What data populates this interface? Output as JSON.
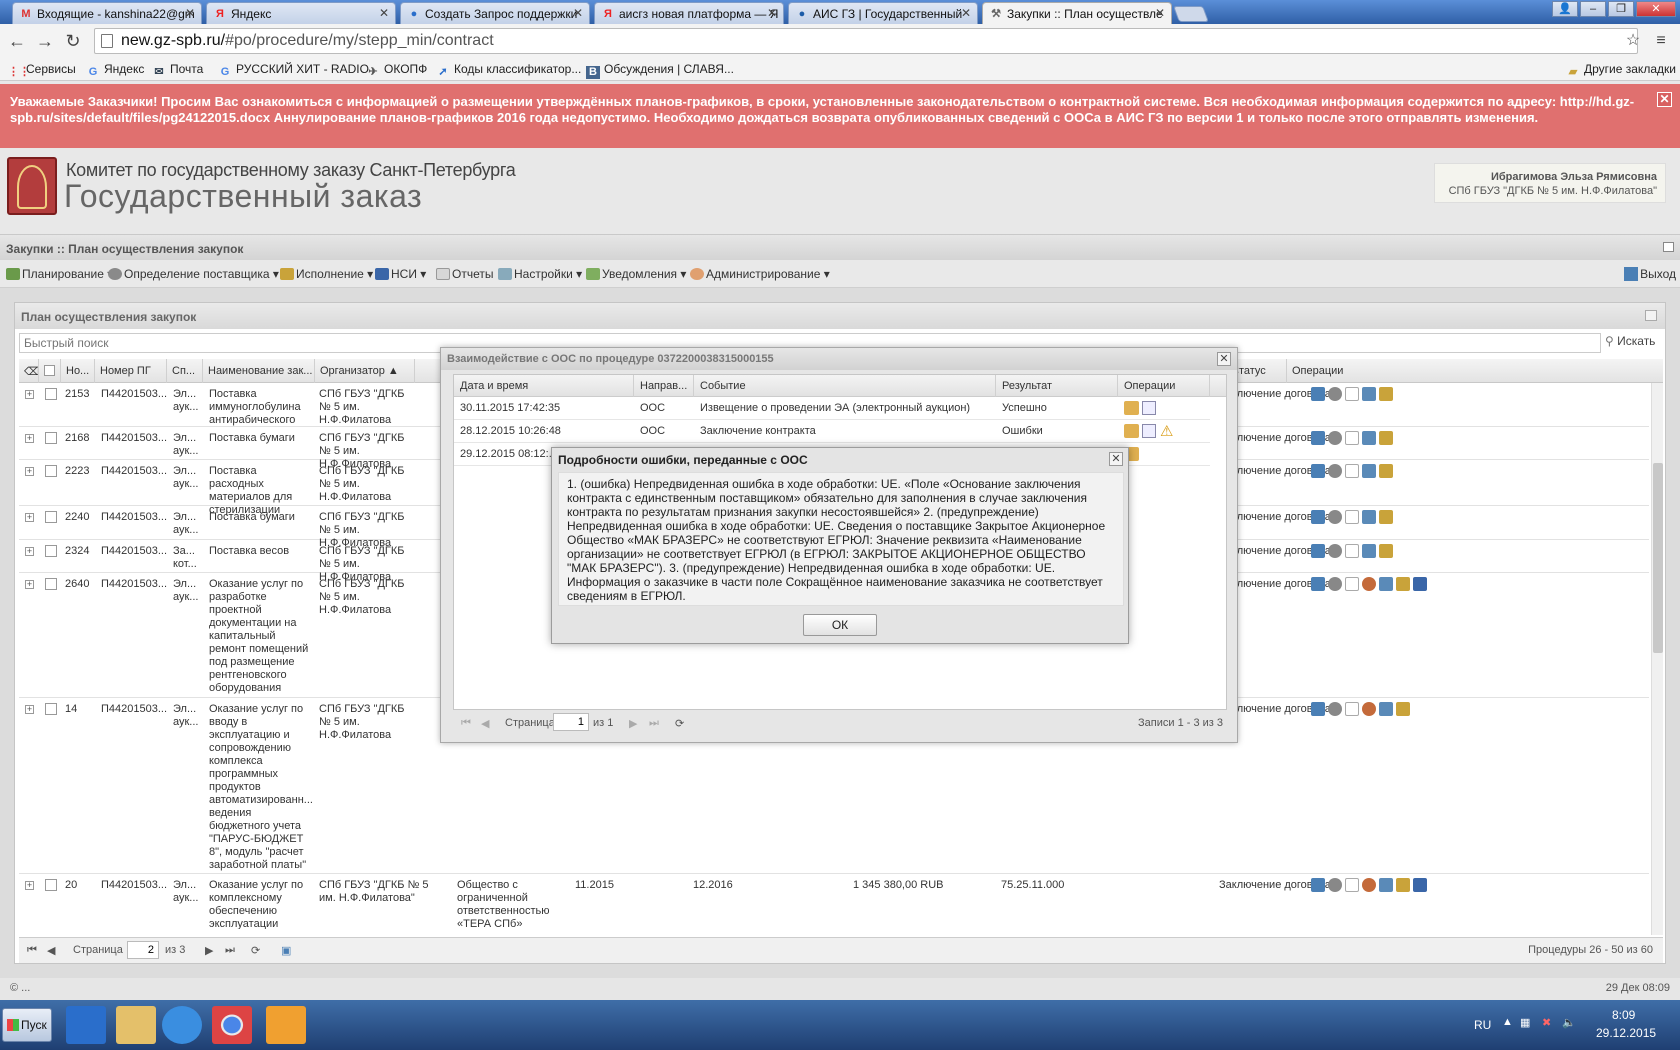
{
  "browser": {
    "tabs": [
      {
        "label": "Входящие - kanshina22@gm",
        "icon": "gmail-icon"
      },
      {
        "label": "Яндекс",
        "icon": "yandex-icon"
      },
      {
        "label": "Создать Запрос поддержки",
        "icon": "globe-icon"
      },
      {
        "label": "аисгз новая платформа — Я",
        "icon": "yandex-icon"
      },
      {
        "label": "АИС ГЗ | Государственный",
        "icon": "globe-icon"
      },
      {
        "label": "Закупки :: План осуществле",
        "icon": "hammer-icon"
      }
    ],
    "url_host": "new.gz-spb.ru/",
    "url_path": "#po/procedure/my/stepp_min/contract",
    "bookmarks": [
      "Сервисы",
      "Яндекс",
      "Почта",
      "РУССКИЙ ХИТ - RADIO",
      "ОКОПФ",
      "Коды классификатор...",
      "Обсуждения | СЛАВЯ..."
    ],
    "other_bookmarks": "Другие закладки"
  },
  "alert": {
    "text": "Уважаемые Заказчики! Просим Вас ознакомиться с информацией о размещении утверждённых планов-графиков, в сроки, установленные законодательством о контрактной системе. Вся необходимая информация содержится по адресу: http://hd.gz-spb.ru/sites/default/files/pg24122015.docx Аннулирование планов-графиков 2016 года недопустимо. Необходимо дождаться возврата опубликованных сведений с ООСа в АИС ГЗ по версии 1 и только после этого отправлять изменения.",
    "close": "✕"
  },
  "header": {
    "org_line1": "Комитет по государственному заказу Санкт-Петербурга",
    "org_line2": "Государственный заказ",
    "user_name": "Ибрагимова Эльза Рямисовна",
    "user_org": "СПб ГБУЗ \"ДГКБ № 5 им. Н.Ф.Филатова\""
  },
  "main": {
    "title": "Закупки :: План осуществления закупок",
    "menu": [
      "Планирование",
      "Определение поставщика",
      "Исполнение",
      "НСИ",
      "Отчеты",
      "Настройки",
      "Уведомления",
      "Администрирование"
    ],
    "exit": "Выход"
  },
  "grid": {
    "title": "План осуществления закупок",
    "quick_search_placeholder": "Быстрый поиск",
    "search_button": "Искать",
    "columns": [
      "Но...",
      "Номер ПГ",
      "Сп...",
      "Наименование зак...",
      "Организатор ▲",
      "Статус",
      "Операции"
    ],
    "rows": [
      {
        "no": "2153",
        "pg": "П44201503...",
        "sp": "Эл... аук...",
        "name": "Поставка иммуноглобулина антирабического",
        "org": "СПб ГБУЗ \"ДГКБ № 5 им. Н.Ф.Филатова",
        "status": "Заключение договора"
      },
      {
        "no": "2168",
        "pg": "П44201503...",
        "sp": "Эл... аук...",
        "name": "Поставка бумаги",
        "org": "СПб ГБУЗ \"ДГКБ № 5 им. Н.Ф.Филатова",
        "status": "Заключение договора"
      },
      {
        "no": "2223",
        "pg": "П44201503...",
        "sp": "Эл... аук...",
        "name": "Поставка расходных материалов для стерилизации",
        "org": "СПб ГБУЗ \"ДГКБ № 5 им. Н.Ф.Филатова",
        "status": "Заключение договора"
      },
      {
        "no": "2240",
        "pg": "П44201503...",
        "sp": "Эл... аук...",
        "name": "Поставка бумаги",
        "org": "СПб ГБУЗ \"ДГКБ № 5 им. Н.Ф.Филатова",
        "status": "Заключение договора"
      },
      {
        "no": "2324",
        "pg": "П44201503...",
        "sp": "За... кот...",
        "name": "Поставка весов",
        "org": "СПб ГБУЗ \"ДГКБ № 5 им. Н.Ф.Филатова",
        "status": "Заключение договора"
      },
      {
        "no": "2640",
        "pg": "П44201503...",
        "sp": "Эл... аук...",
        "name": "Оказание услуг по разработке проектной документации на капитальный ремонт помещений под размещение рентгеновского оборудования",
        "org": "СПб ГБУЗ \"ДГКБ № 5 им. Н.Ф.Филатова",
        "status": "Заключение договора"
      },
      {
        "no": "14",
        "pg": "П44201503...",
        "sp": "Эл... аук...",
        "name": "Оказание услуг по вводу в эксплуатацию и сопровождению комплекса программных продуктов автоматизированн... ведения бюджетного учета \"ПАРУС-БЮДЖЕТ 8\", модуль \"расчет заработной платы\"",
        "org": "СПб ГБУЗ \"ДГКБ № 5 им. Н.Ф.Филатова",
        "status": "Заключение договора"
      },
      {
        "no": "20",
        "pg": "П44201503...",
        "sp": "Эл... аук...",
        "name": "Оказание услуг по комплексному обеспечению эксплуатации",
        "org": "СПб ГБУЗ \"ДГКБ № 5 им. Н.Ф.Филатова\"",
        "status": "Заключение договора",
        "supplier": "Общество с ограниченной ответственностью «ТЕРА СПб»",
        "start": "11.2015",
        "end": "12.2016",
        "price": "1 345 380,00 RUB",
        "okpd": "75.25.11.000"
      }
    ],
    "pager": {
      "label": "Страница",
      "page": "2",
      "of": "из 3",
      "records": "Процедуры 26 - 50 из 60"
    }
  },
  "dialog1": {
    "title": "Взаимодействие с ООС по процедуре 0372200038315000155",
    "columns": [
      "Дата и время",
      "Направ...",
      "Событие",
      "Результат",
      "Операции"
    ],
    "rows": [
      {
        "date": "30.11.2015 17:42:35",
        "dir": "ООС",
        "event": "Извещение о проведении ЭА (электронный аукцион)",
        "result": "Успешно"
      },
      {
        "date": "28.12.2015 10:26:48",
        "dir": "ООС",
        "event": "Заключение контракта",
        "result": "Ошибки"
      },
      {
        "date": "29.12.2015 08:12:..",
        "dir": "",
        "event": "",
        "result": ""
      }
    ],
    "pager": {
      "label": "Страница",
      "page": "1",
      "of": "из 1",
      "records": "Записи 1 - 3 из 3"
    }
  },
  "dialog2": {
    "title": "Подробности ошибки, переданные с ООС",
    "message": "1. (ошибка) Непредвиденная ошибка в ходе обработки: UE. «Поле «Основание заключения контракта с единственным поставщиком» обязательно для заполнения в случае заключения контракта по результатам признания закупки несостоявшейся» 2. (предупреждение) Непредвиденная ошибка в ходе обработки: UE. Сведения о поставщике Закрытое Акционерное Общество «МАК БРАЗЕРС» не соответствуют ЕГРЮЛ: Значение реквизита «Наименование организации» не соответствует ЕГРЮЛ (в ЕГРЮЛ: ЗАКРЫТОЕ АКЦИОНЕРНОЕ ОБЩЕСТВО \"МАК БРАЗЕРС\"). 3. (предупреждение) Непредвиденная ошибка в ходе обработки: UE. Информация о заказчике в части поле Сокращённое наименование заказчика не соответствует сведениям в ЕГРЮЛ.",
    "ok": "ОК"
  },
  "statusbar": {
    "left": "© ...",
    "right": "29 Дек 08:09"
  },
  "taskbar": {
    "start": "Пуск",
    "lang": "RU",
    "time": "8:09",
    "date": "29.12.2015"
  }
}
